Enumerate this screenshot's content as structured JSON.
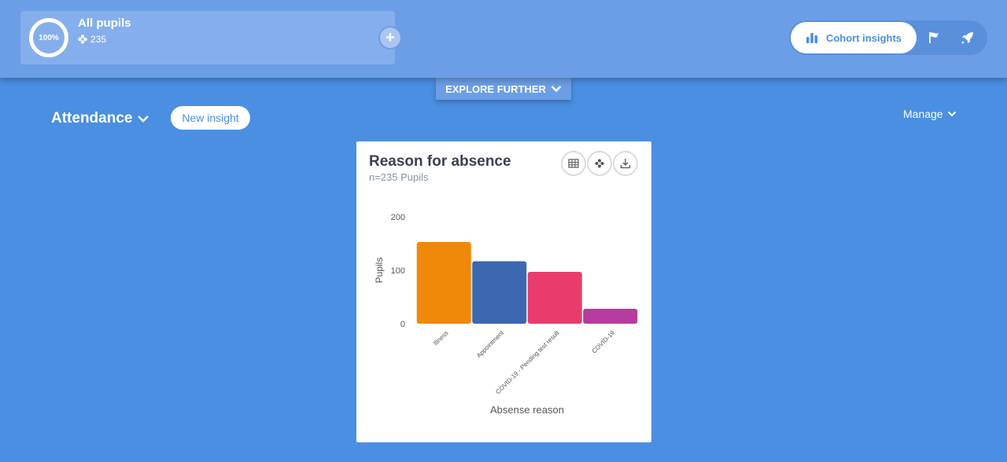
{
  "cohort": {
    "percent": "100%",
    "title": "All pupils",
    "count": "235"
  },
  "view_switch": {
    "active_label": "Cohort insights"
  },
  "explore": {
    "label": "EXPLORE FURTHER"
  },
  "section": {
    "title": "Attendance",
    "new_insight_label": "New insight",
    "manage_label": "Manage"
  },
  "insight": {
    "title": "Reason for absence",
    "subtitle": "n=235 Pupils"
  },
  "colors": {
    "background": "#4a8fe2",
    "topbar": "#6b9ee6",
    "illness": "#f0880a",
    "appointment": "#3b68b0",
    "covid_pending": "#e83d6a",
    "covid": "#b63ca0"
  },
  "chart_data": {
    "type": "bar",
    "categories": [
      "Illness",
      "Appointment",
      "COVID-19 - Pending test result",
      "COVID-19"
    ],
    "values": [
      153,
      117,
      97,
      28
    ],
    "colors": [
      "#f0880a",
      "#3b68b0",
      "#e83d6a",
      "#b63ca0"
    ],
    "xlabel": "Absense reason",
    "ylabel": "Pupils",
    "yticks": [
      0,
      100,
      200
    ],
    "ylim": [
      0,
      200
    ]
  }
}
